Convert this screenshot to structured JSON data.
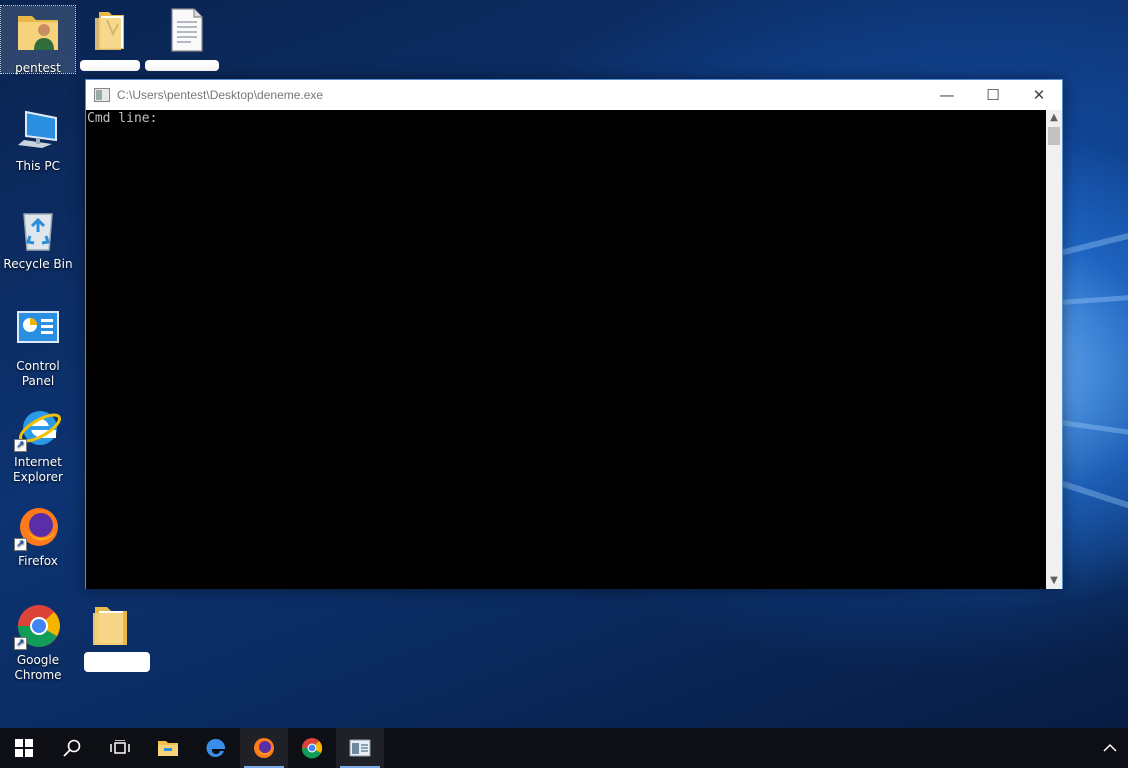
{
  "desktop": {
    "icons": [
      {
        "label": "pentest",
        "icon": "user-folder-icon"
      },
      {
        "label": "This PC",
        "icon": "computer-icon"
      },
      {
        "label": "Recycle Bin",
        "icon": "recycle-bin-icon"
      },
      {
        "label": "Control Panel",
        "icon": "control-panel-icon"
      },
      {
        "label": "Internet Explorer",
        "icon": "internet-explorer-icon"
      },
      {
        "label": "Firefox",
        "icon": "firefox-icon"
      },
      {
        "label": "Google Chrome",
        "icon": "chrome-icon"
      }
    ],
    "second_column_icons": [
      {
        "icon": "folder-icon"
      },
      {
        "icon": "text-document-icon"
      },
      {
        "icon": "folder-icon"
      }
    ]
  },
  "window": {
    "title": "C:\\Users\\pentest\\Desktop\\deneme.exe",
    "console_text": "Cmd line:",
    "buttons": {
      "minimize": "—",
      "maximize": "☐",
      "close": "✕"
    }
  },
  "taskbar": {
    "items": [
      "start-icon",
      "search-icon",
      "task-view-icon",
      "file-explorer-icon",
      "edge-icon",
      "firefox-icon",
      "chrome-icon",
      "console-app-icon"
    ],
    "tray": [
      "show-hidden-icons"
    ]
  },
  "colors": {
    "taskbar": "#0d0f14",
    "console_bg": "#000000",
    "console_fg": "#c0c0c0",
    "window_border": "#5a8fd6"
  }
}
